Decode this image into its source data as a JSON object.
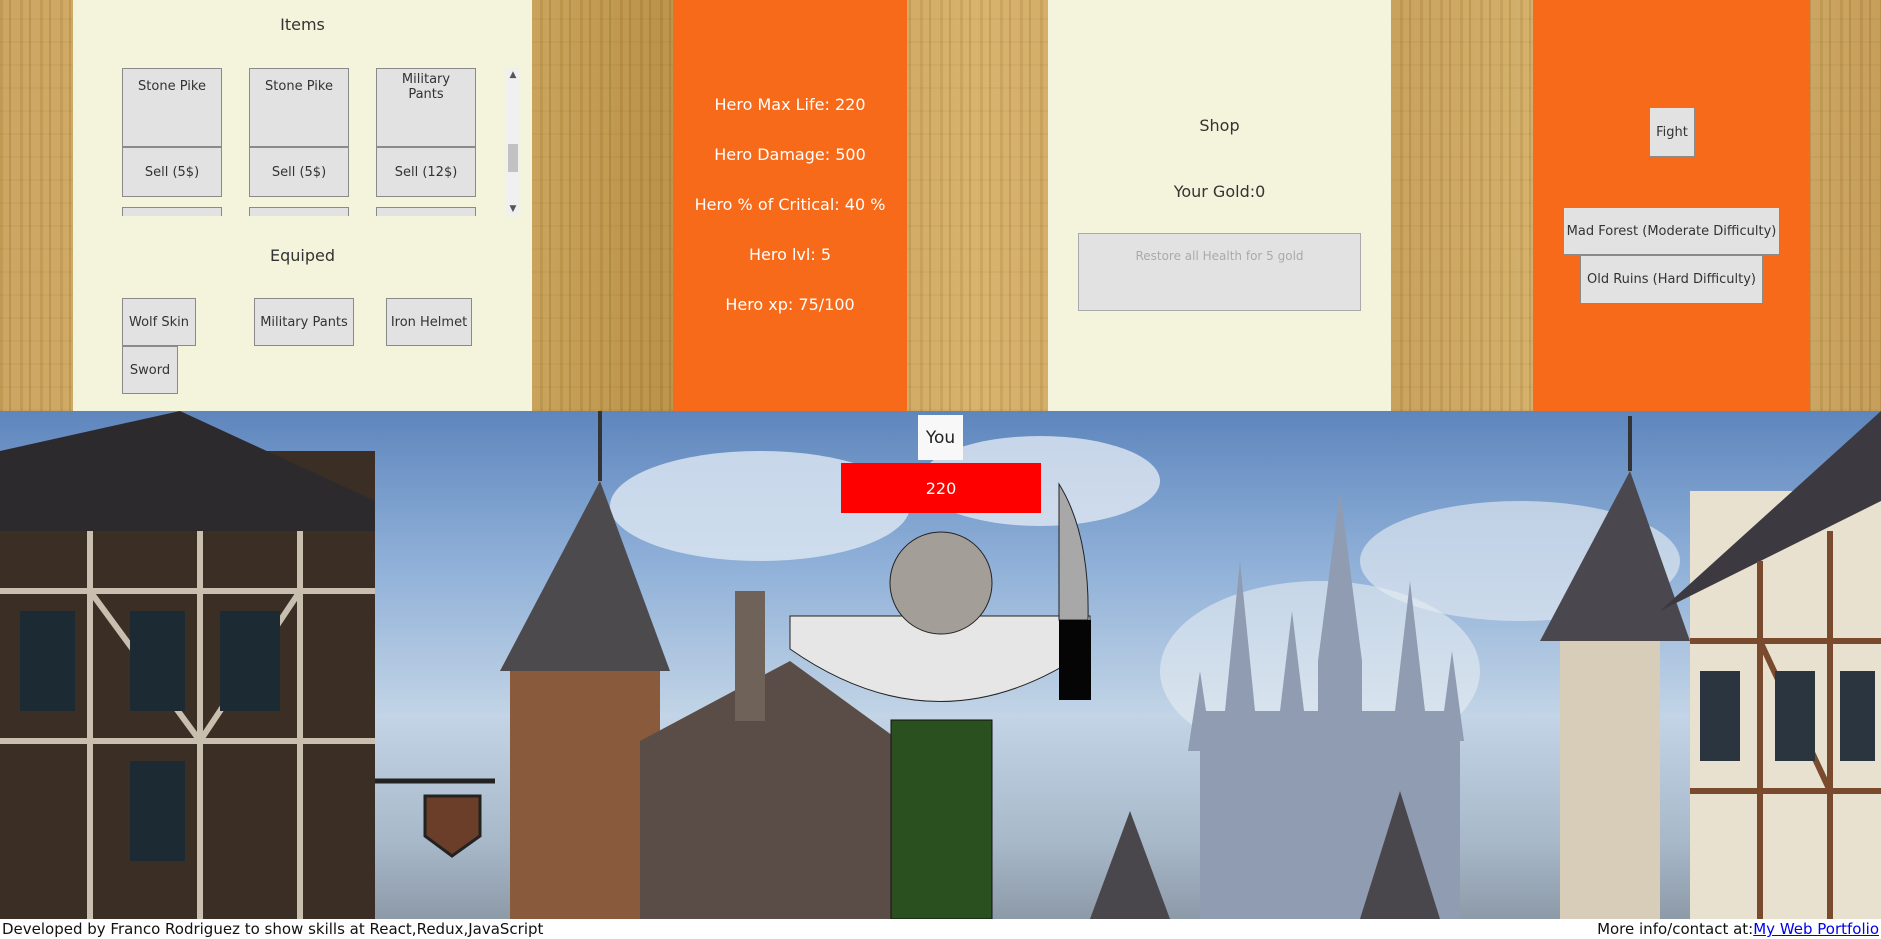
{
  "inventory": {
    "title": "Items",
    "items": [
      {
        "name": "Stone Pike",
        "sell_label": "Sell (5$)"
      },
      {
        "name": "Stone Pike",
        "sell_label": "Sell (5$)"
      },
      {
        "name": "Military Pants",
        "sell_label": "Sell (12$)"
      }
    ],
    "equipped_title": "Equiped",
    "equipped": [
      "Wolf Skin",
      "Military Pants",
      "Iron Helmet",
      "Sword"
    ]
  },
  "stats": {
    "max_life": "Hero Max Life: 220",
    "damage": "Hero Damage: 500",
    "critical": "Hero % of Critical: 40 %",
    "level": "Hero lvl: 5",
    "xp": "Hero xp: 75/100"
  },
  "shop": {
    "title": "Shop",
    "gold": "Your Gold:0",
    "restore_label": "Restore all Health for 5 gold"
  },
  "fight": {
    "fight_label": "Fight",
    "zones": [
      "Mad Forest (Moderate Difficulty)",
      "Old Ruins (Hard Difficulty)"
    ]
  },
  "hero": {
    "name_label": "You",
    "health": "220"
  },
  "colors": {
    "accent_orange": "#f76a19",
    "panel_cream": "#f4f4dc",
    "health_red": "#ff0000",
    "torso_green": "#2a501f"
  },
  "footer": {
    "credit": "Developed by Franco Rodriguez to show skills at React,Redux,JavaScript",
    "contact_prefix": "More info/contact at:",
    "portfolio_link": "My Web Portfolio"
  }
}
